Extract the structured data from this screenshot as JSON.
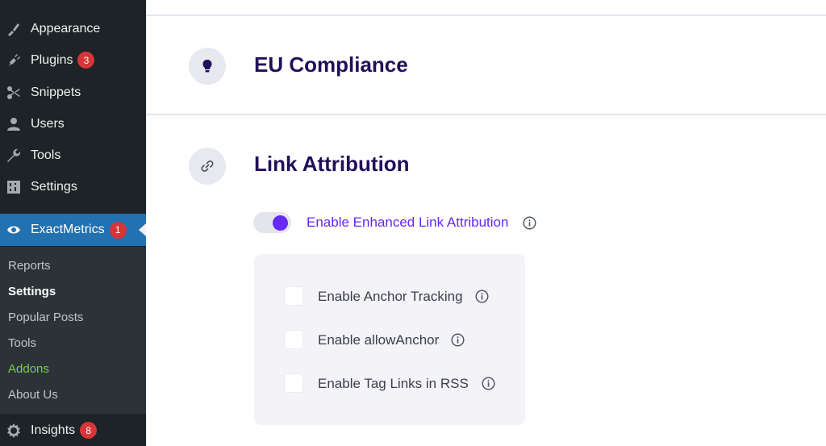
{
  "sidebar": {
    "menu": [
      {
        "label": "Appearance",
        "icon": "paintbrush-icon"
      },
      {
        "label": "Plugins",
        "icon": "plugin-icon",
        "badge": "3"
      },
      {
        "label": "Snippets",
        "icon": "scissors-icon"
      },
      {
        "label": "Users",
        "icon": "user-icon"
      },
      {
        "label": "Tools",
        "icon": "wrench-icon"
      },
      {
        "label": "Settings",
        "icon": "settings-sliders-icon"
      }
    ],
    "current": {
      "label": "ExactMetrics",
      "icon": "exactmetrics-logo-icon",
      "badge": "1"
    },
    "submenu": [
      {
        "label": "Reports"
      },
      {
        "label": "Settings",
        "active": true
      },
      {
        "label": "Popular Posts"
      },
      {
        "label": "Tools"
      },
      {
        "label": "Addons"
      },
      {
        "label": "About Us"
      }
    ],
    "insights": {
      "label": "Insights",
      "icon": "insights-gear-icon",
      "badge": "8"
    }
  },
  "main": {
    "eu_section": {
      "title": "EU Compliance",
      "icon": "lightbulb-icon"
    },
    "link_section": {
      "title": "Link Attribution",
      "icon": "link-icon",
      "toggle": {
        "label": "Enable Enhanced Link Attribution",
        "enabled": true
      },
      "options": [
        {
          "label": "Enable Anchor Tracking",
          "checked": false
        },
        {
          "label": "Enable allowAnchor",
          "checked": false
        },
        {
          "label": "Enable Tag Links in RSS",
          "checked": false
        }
      ]
    }
  },
  "colors": {
    "sidebar_bg": "#1d2327",
    "submenu_bg": "#2c3338",
    "current_bg": "#2271b1",
    "badge": "#d63638",
    "accent_purple": "#6528f5",
    "title_navy": "#210f59",
    "addons_green": "#7ad03a"
  }
}
